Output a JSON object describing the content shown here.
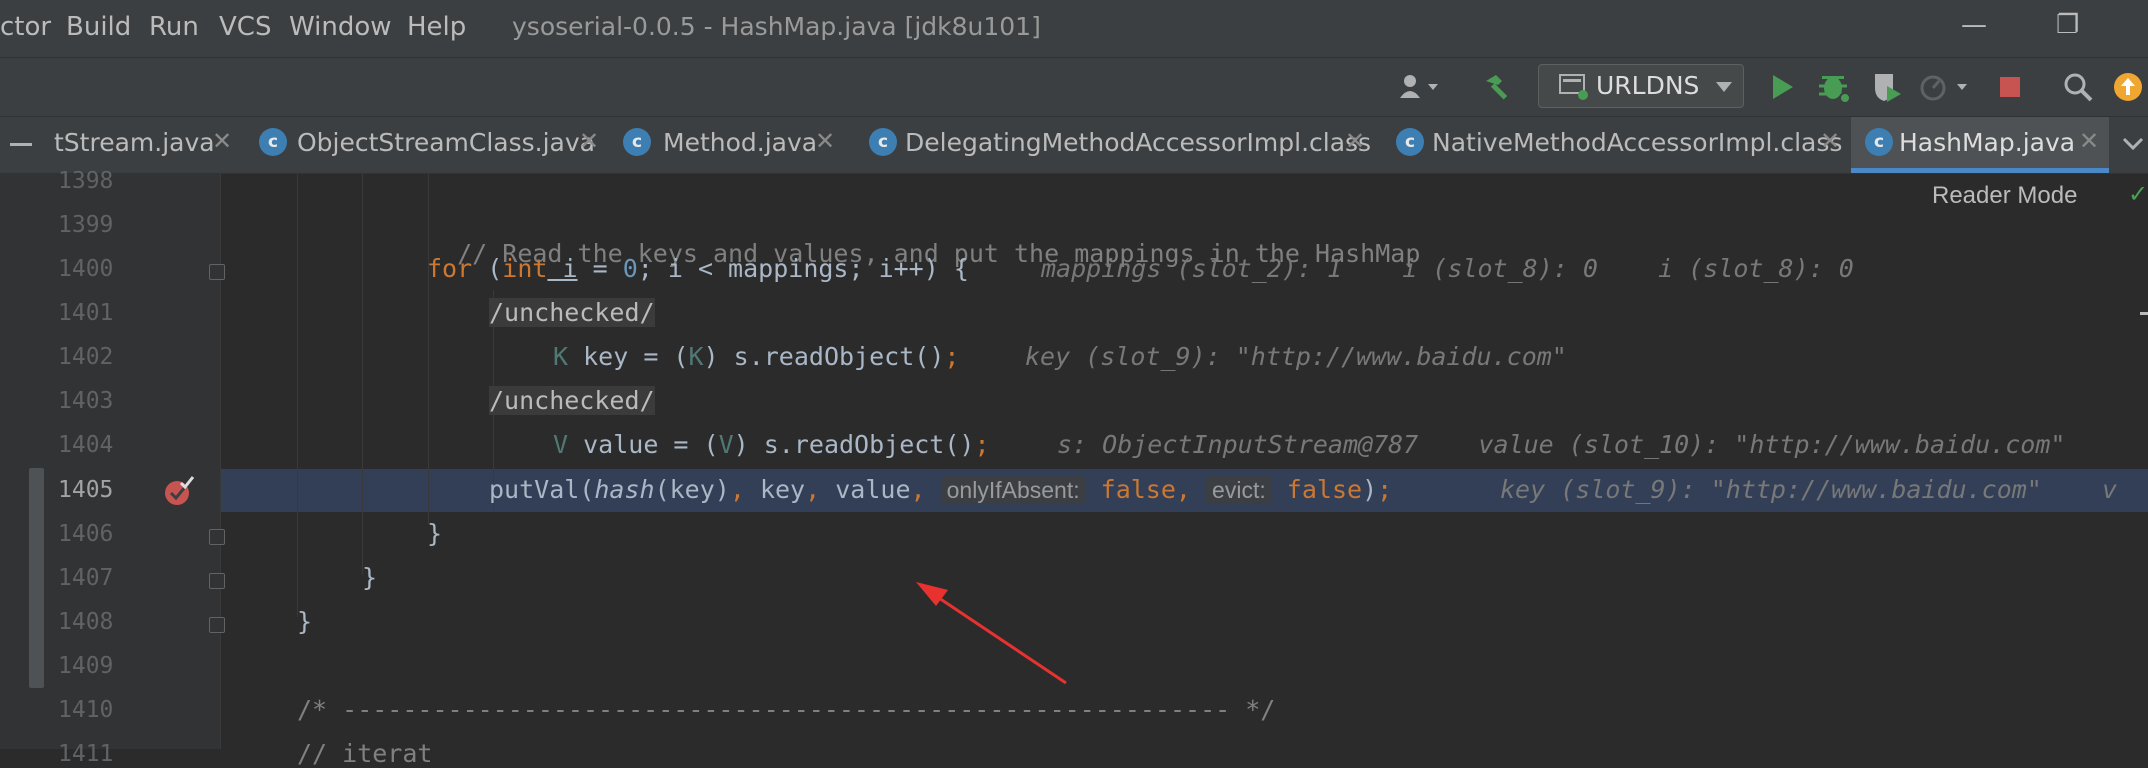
{
  "menubar": {
    "items": [
      "ctor",
      "Build",
      "Run",
      "VCS",
      "Window",
      "Help"
    ],
    "window_title": "ysoserial-0.0.5 - HashMap.java [jdk8u101]",
    "minimize": "—",
    "restore": "❐"
  },
  "toolbar": {
    "run_config": "URLDNS",
    "icons": [
      "user-icon",
      "build-hammer-icon",
      "run-icon",
      "debug-icon",
      "coverage-icon",
      "profile-icon",
      "stop-icon",
      "search-icon",
      "update-icon"
    ],
    "colors": {
      "run": "#499c54",
      "stop": "#c75450",
      "update": "#f0a732"
    }
  },
  "tabs": [
    {
      "label": "tStream.java",
      "close": "✕"
    },
    {
      "label": "ObjectStreamClass.java",
      "close": "✕"
    },
    {
      "label": "Method.java",
      "close": "✕"
    },
    {
      "label": "DelegatingMethodAccessorImpl.class",
      "close": "✕"
    },
    {
      "label": "NativeMethodAccessorImpl.class",
      "close": "✕"
    },
    {
      "label": "HashMap.java",
      "close": "✕",
      "active": true
    }
  ],
  "editor": {
    "reader_mode": "Reader Mode",
    "line_numbers": [
      "1398",
      "1399",
      "1400",
      "1401",
      "1402",
      "1403",
      "1404",
      "1405",
      "1406",
      "1407",
      "1408",
      "1409",
      "1410",
      "1411"
    ],
    "current_line": "1405",
    "code": {
      "l1399": "// Read the keys and values, and put the mappings in the HashMap",
      "l1400_for": "for",
      "l1400_open": " (",
      "l1400_int": "int",
      "l1400_i1": " i",
      "l1400_eq": " = ",
      "l1400_zero": "0",
      "l1400_rest": "; i < mappings; i++) {",
      "l1400_hint": "mappings (slot_2): 1    i (slot_8): 0    i (slot_8): 0",
      "l1401": "/unchecked/",
      "l1402_K1": "K",
      "l1402_mid": " key = (",
      "l1402_K2": "K",
      "l1402_rest": ") s.readObject()",
      "l1402_semi": ";",
      "l1402_hint": "key (slot_9): \"http://www.baidu.com\"",
      "l1403": "/unchecked/",
      "l1404_V1": "V",
      "l1404_mid": " value = (",
      "l1404_V2": "V",
      "l1404_rest": ") s.readObject()",
      "l1404_semi": ";",
      "l1404_hint": "s: ObjectInputStream@787    value (slot_10): \"http://www.baidu.com\"",
      "l1405_call": "putVal(",
      "l1405_hash": "hash",
      "l1405_args": "(key)",
      "l1405_c1": ",",
      "l1405_key": " key",
      "l1405_c2": ",",
      "l1405_value": " value",
      "l1405_c3": ",",
      "l1405_p1": "onlyIfAbsent:",
      "l1405_false1": "false",
      "l1405_c4": ",",
      "l1405_p2": "evict:",
      "l1405_false2": "false",
      "l1405_end": ")",
      "l1405_semi": ";",
      "l1405_hint": "key (slot_9): \"http://www.baidu.com\"    v",
      "l1406": "}",
      "l1407": "}",
      "l1408": "}",
      "l1410": "/* ----------------------------------------------------------- */",
      "l1411": "// iterat"
    }
  }
}
